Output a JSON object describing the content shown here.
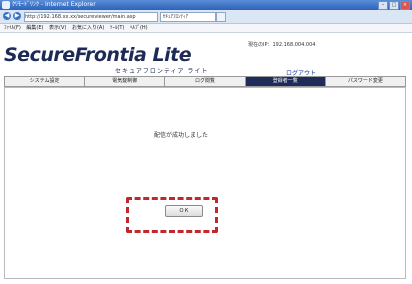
{
  "browser": {
    "title": "ｸﾘﾓｰﾄﾞﾘﾝｸ - Internet Explorer",
    "address": "http://192.168.xx.xx/secureviewer/main.asp",
    "tab_label": "ｾｷｭｱﾌﾛﾝﾃｨｱ",
    "menu": [
      "ﾌｧｲﾙ(F)",
      "編集(E)",
      "表示(V)",
      "お気に入り(A)",
      "ﾂｰﾙ(T)",
      "ﾍﾙﾌﾟ(H)"
    ]
  },
  "header": {
    "logo": "SecureFrontia Lite",
    "logo_sub": "セキュアフロンティア ライト",
    "ip_info": "現在のIP：192.168.004.004",
    "logout": "ログアウト"
  },
  "nav": {
    "items": [
      {
        "label": "システム設定",
        "active": false
      },
      {
        "label": "電気錠制御",
        "active": false
      },
      {
        "label": "ログ閲覧",
        "active": false
      },
      {
        "label": "登録者一覧",
        "active": true
      },
      {
        "label": "パスワード変更",
        "active": false
      }
    ]
  },
  "main": {
    "message": "配信が成功しました",
    "ok_label": "ＯＫ"
  },
  "colors": {
    "highlight": "#c1272d",
    "nav_active": "#1f2c5a"
  }
}
